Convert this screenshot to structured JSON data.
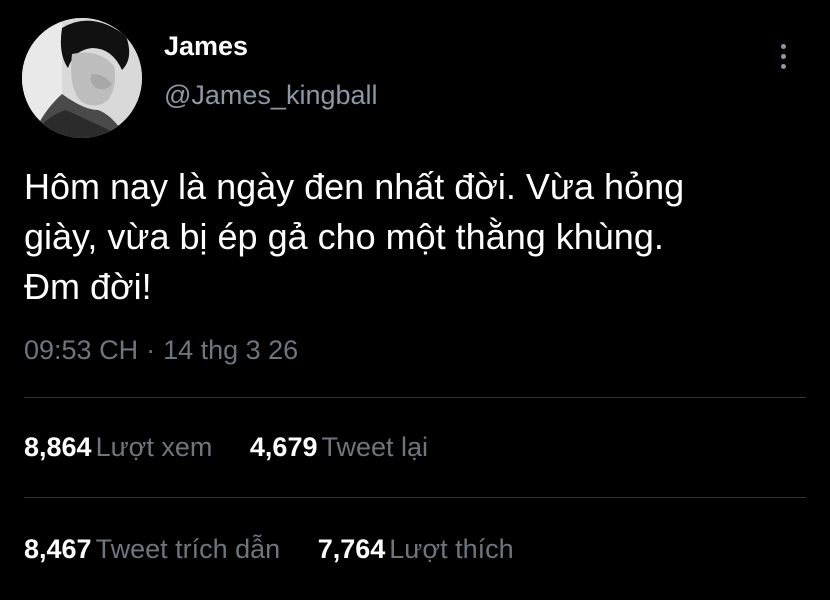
{
  "tweet": {
    "author": {
      "display_name": "James",
      "handle": "@James_kingball"
    },
    "text": "Hôm nay là ngày đen nhất đời. Vừa hỏng\ngiày, vừa bị ép gả cho một thằng khùng.\nĐm đời!",
    "time": "09:53 CH",
    "date": "14 thg 3 26",
    "separator": "·",
    "stats": {
      "views": {
        "count": "8,864",
        "label": "Lượt xem"
      },
      "retweets": {
        "count": "4,679",
        "label": "Tweet lại"
      },
      "quotes": {
        "count": "8,467",
        "label": "Tweet trích dẫn"
      },
      "likes": {
        "count": "7,764",
        "label": "Lượt thích"
      }
    }
  },
  "icons": {
    "more": "more-vertical-icon",
    "avatar": "profile-photo"
  },
  "colors": {
    "background": "#000000",
    "primary_text": "#ffffff",
    "secondary_text": "#8b98a5",
    "muted_text": "#6e767d",
    "divider": "#2f3336"
  }
}
